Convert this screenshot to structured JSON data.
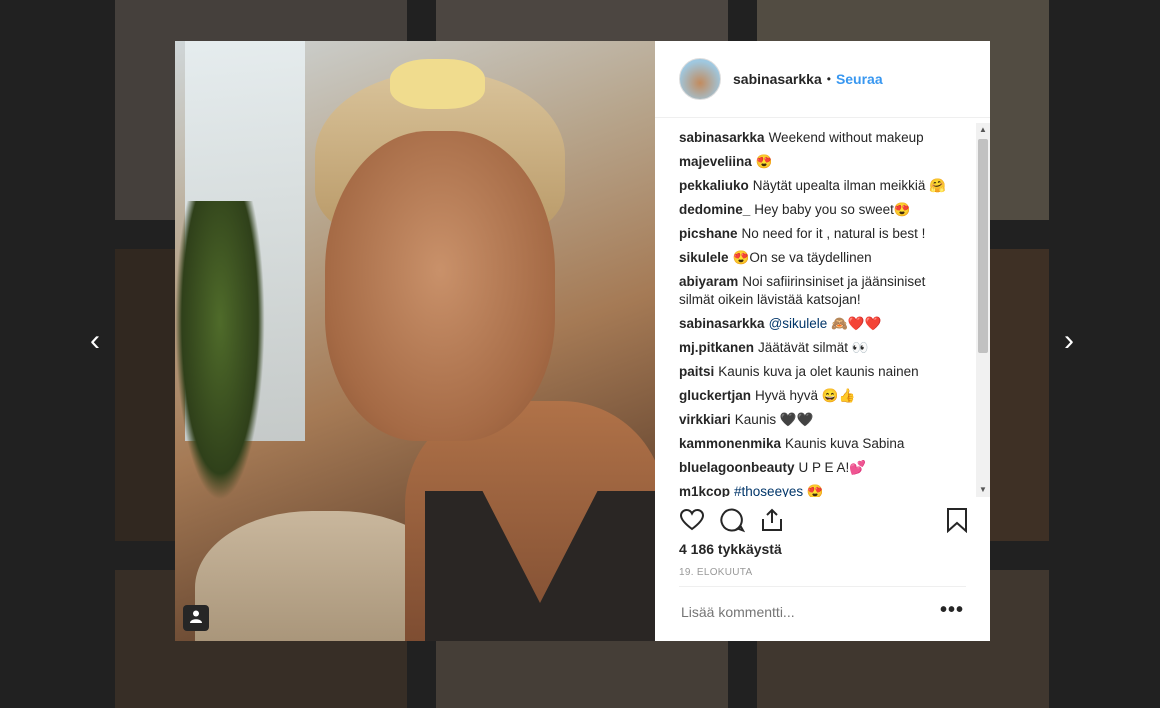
{
  "post": {
    "username": "sabinasarkka",
    "separator": "•",
    "follow_label": "Seuraa",
    "likes_text": "4 186 tykkäystä",
    "date_text": "19. ELOKUUTA",
    "add_comment_placeholder": "Lisää kommentti...",
    "more_label": "•••"
  },
  "comments": [
    {
      "user": "sabinasarkka",
      "text": "Weekend without makeup"
    },
    {
      "user": "majeveliina",
      "text": "😍"
    },
    {
      "user": "pekkaliuko",
      "text": "Näytät upealta ilman meikkiä 🤗"
    },
    {
      "user": "dedomine_",
      "text": "Hey baby you so sweet😍"
    },
    {
      "user": "picshane",
      "text": "No need for it , natural is best !"
    },
    {
      "user": "sikulele",
      "text": "😍On se va täydellinen"
    },
    {
      "user": "abiyaram",
      "text": "Noi safiirinsiniset ja jäänsiniset silmät oikein lävistää katsojan!"
    },
    {
      "user": "sabinasarkka",
      "mention": "@sikulele",
      "text": "🙈❤️❤️"
    },
    {
      "user": "mj.pitkanen",
      "text": "Jäätävät silmät 👀"
    },
    {
      "user": "paitsi",
      "text": "Kaunis kuva ja olet kaunis nainen"
    },
    {
      "user": "gluckertjan",
      "text": "Hyvä hyvä 😄👍"
    },
    {
      "user": "virkkiari",
      "text": "Kaunis 🖤🖤"
    },
    {
      "user": "kammonenmika",
      "text": "Kaunis kuva Sabina"
    },
    {
      "user": "bluelagoonbeauty",
      "text": "U P E A!💕"
    },
    {
      "user": "m1kcop",
      "mention": "#thoseeyes",
      "text": "😍"
    }
  ],
  "icons": {
    "heart": "heart-icon",
    "comment": "comment-icon",
    "share": "share-icon",
    "save": "bookmark-icon",
    "prev": "chevron-left-icon",
    "next": "chevron-right-icon",
    "user_tag": "user-tag-icon"
  },
  "nav": {
    "prev": "‹",
    "next": "›"
  },
  "colors": {
    "link": "#3897f0",
    "text": "#262626",
    "muted": "#999999",
    "backdrop": "#000000"
  }
}
